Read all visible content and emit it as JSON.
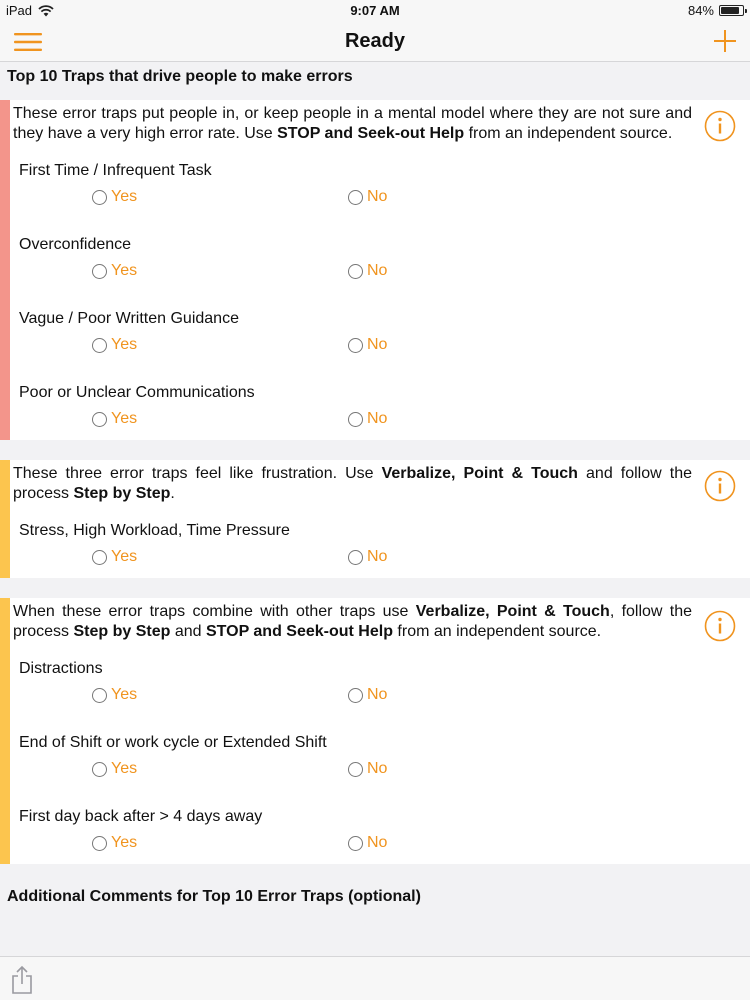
{
  "status_bar": {
    "device": "iPad",
    "time": "9:07 AM",
    "battery_text": "84%",
    "battery_level": 0.84
  },
  "nav": {
    "title": "Ready"
  },
  "colors": {
    "accent": "#f0941f",
    "red_bar": "#f3958b",
    "yellow_bar": "#fcc54e"
  },
  "heading": "Top 10 Traps that drive people to make errors",
  "groups": [
    {
      "color": "red",
      "desc": [
        {
          "t": "These error traps put people in, or keep people in a mental model where they are not sure and they have a very high error rate. Use ",
          "b": false
        },
        {
          "t": "STOP and Seek-out Help",
          "b": true
        },
        {
          "t": " from an independent source.",
          "b": false
        }
      ],
      "questions": [
        {
          "label": "First Time / Infrequent Task",
          "yes": "Yes",
          "no": "No"
        },
        {
          "label": "Overconfidence",
          "yes": "Yes",
          "no": "No"
        },
        {
          "label": "Vague / Poor Written Guidance",
          "yes": "Yes",
          "no": "No"
        },
        {
          "label": "Poor or Unclear Communications",
          "yes": "Yes",
          "no": "No"
        }
      ]
    },
    {
      "color": "yellow",
      "desc": [
        {
          "t": "These three error traps feel like frustration. Use ",
          "b": false
        },
        {
          "t": "Verbalize, Point & Touch",
          "b": true
        },
        {
          "t": " and follow the process ",
          "b": false
        },
        {
          "t": "Step by Step",
          "b": true
        },
        {
          "t": ".",
          "b": false
        }
      ],
      "questions": [
        {
          "label": "Stress, High Workload, Time Pressure",
          "yes": "Yes",
          "no": "No"
        }
      ]
    },
    {
      "color": "yellow",
      "desc": [
        {
          "t": "When these error traps combine with other traps use ",
          "b": false
        },
        {
          "t": "Verbalize, Point & Touch",
          "b": true
        },
        {
          "t": ", follow the process ",
          "b": false
        },
        {
          "t": "Step by Step",
          "b": true
        },
        {
          "t": " and ",
          "b": false
        },
        {
          "t": "STOP and Seek-out Help",
          "b": true
        },
        {
          "t": " from an independent source.",
          "b": false
        }
      ],
      "questions": [
        {
          "label": "Distractions",
          "yes": "Yes",
          "no": "No"
        },
        {
          "label": "End of Shift or work cycle or Extended Shift",
          "yes": "Yes",
          "no": "No"
        },
        {
          "label": "First day back after > 4 days away",
          "yes": "Yes",
          "no": "No"
        }
      ]
    }
  ],
  "footer_heading": "Additional Comments for Top 10 Error Traps (optional)",
  "icons": {
    "wifi": "wifi-icon",
    "battery": "battery-icon",
    "menu": "hamburger-menu-icon",
    "add": "plus-icon",
    "info": "info-icon",
    "share": "share-icon"
  }
}
